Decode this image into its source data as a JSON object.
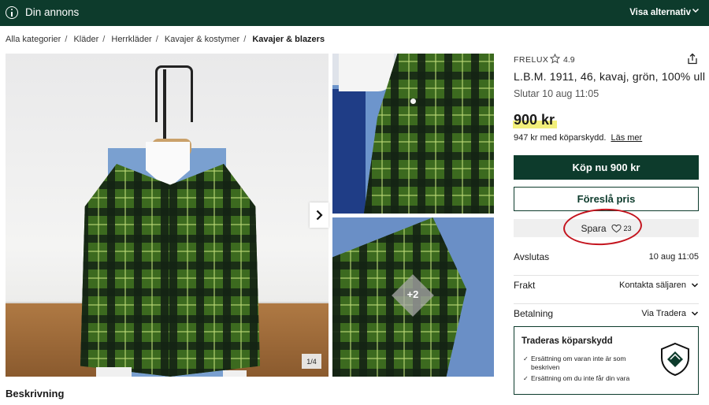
{
  "topbar": {
    "title": "Din annons",
    "options_label": "Visa alternativ"
  },
  "breadcrumb": [
    "Alla kategorier",
    "Kläder",
    "Herrkläder",
    "Kavajer & kostymer",
    "Kavajer & blazers"
  ],
  "gallery": {
    "counter": "1/4",
    "more_label": "+2"
  },
  "section": {
    "description_heading": "Beskrivning"
  },
  "listing": {
    "seller": "FRELUX",
    "rating": "4.9",
    "title": "L.B.M. 1911, 46, kavaj, grön, 100% ull",
    "ends": "Slutar 10 aug 11:05",
    "price": "900 kr",
    "protection_price": "947 kr med köparskydd.",
    "read_more": "Läs mer"
  },
  "actions": {
    "buy_label": "Köp nu 900 kr",
    "offer_label": "Föreslå pris",
    "save_label": "Spara",
    "save_count": "23"
  },
  "details": {
    "ends_label": "Avslutas",
    "ends_value": "10 aug 11:05",
    "shipping_label": "Frakt",
    "shipping_value": "Kontakta säljaren",
    "payment_label": "Betalning",
    "payment_value": "Via Tradera"
  },
  "protection_box": {
    "heading": "Traderas köparskydd",
    "items": [
      "Ersättning om varan inte är som beskriven",
      "Ersättning om du inte får din vara"
    ]
  },
  "colors": {
    "brand_green": "#0d3b2c",
    "price_highlight": "#f2ef7a",
    "annotation_red": "#c4141e"
  },
  "icons": [
    "info-icon",
    "chevron-down-icon",
    "chevron-right-icon",
    "star-icon",
    "share-icon",
    "heart-icon",
    "check-icon",
    "shield-icon"
  ]
}
